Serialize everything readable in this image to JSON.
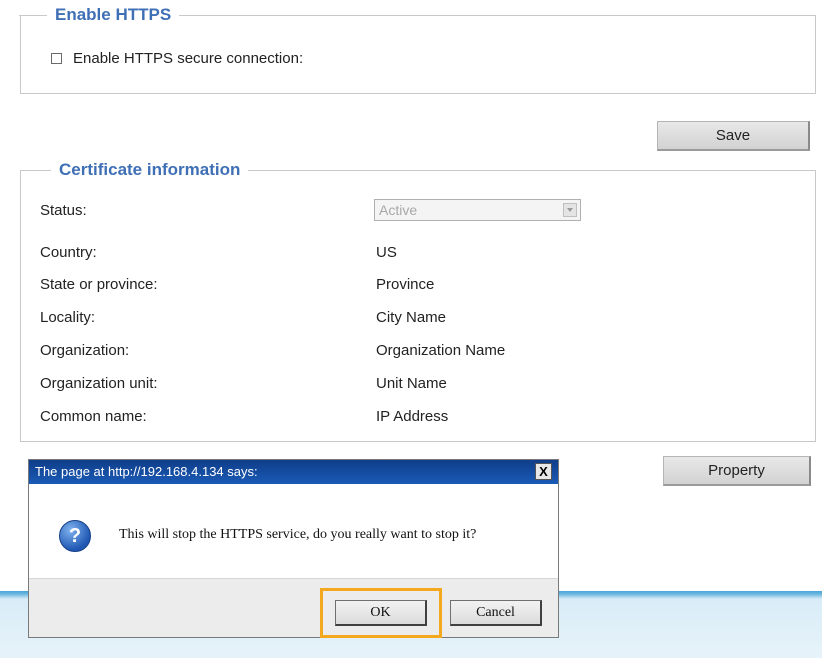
{
  "https_section": {
    "title": "Enable HTTPS",
    "checkbox_label": "Enable HTTPS secure connection:",
    "checked": false
  },
  "save_label": "Save",
  "cert_section": {
    "title": "Certificate information",
    "rows": [
      {
        "label": "Status:",
        "value": "Active",
        "type": "select"
      },
      {
        "label": "Country:",
        "value": "US"
      },
      {
        "label": "State or province:",
        "value": "Province"
      },
      {
        "label": "Locality:",
        "value": "City Name"
      },
      {
        "label": "Organization:",
        "value": "Organization Name"
      },
      {
        "label": "Organization unit:",
        "value": "Unit Name"
      },
      {
        "label": "Common name:",
        "value": "IP Address"
      }
    ]
  },
  "property_label": "Property",
  "dialog": {
    "title": "The page at http://192.168.4.134 says:",
    "close_glyph": "X",
    "icon": "question-icon",
    "message": "This will stop the HTTPS service, do you really want to stop it?",
    "ok_label": "OK",
    "cancel_label": "Cancel"
  },
  "colors": {
    "legend": "#3f6fb5",
    "titlebar": "#1a4fa3",
    "highlight": "#f4a81d",
    "band": "#4aa5d8"
  }
}
